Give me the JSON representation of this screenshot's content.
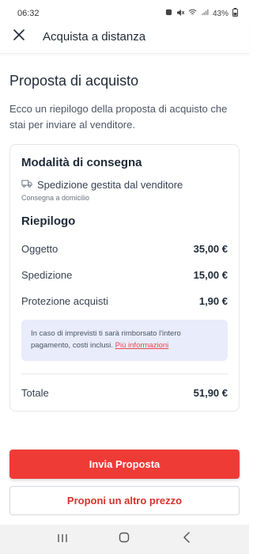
{
  "status_bar": {
    "time": "06:32",
    "battery": "43%"
  },
  "app_bar": {
    "title": "Acquista a distanza",
    "close_icon": "close-icon"
  },
  "page": {
    "title": "Proposta di acquisto",
    "description": "Ecco un riepilogo della proposta di acquisto che stai per inviare al venditore."
  },
  "delivery": {
    "title": "Modalità di consegna",
    "method": "Spedizione gestita dal venditore",
    "method_icon": "truck-icon",
    "sub": "Consegna a domicilio"
  },
  "summary": {
    "title": "Riepilogo",
    "rows": [
      {
        "label": "Oggetto",
        "value": "35,00 €"
      },
      {
        "label": "Spedizione",
        "value": "15,00 €"
      },
      {
        "label": "Protezione acquisti",
        "value": "1,90 €"
      }
    ],
    "info_text": "In caso di imprevisti ti sarà rimborsato l'intero pagamento, costi inclusi.",
    "info_link": "Più informazioni",
    "total_label": "Totale",
    "total_value": "51,90 €"
  },
  "actions": {
    "primary": "Invia Proposta",
    "secondary": "Proponi un altro prezzo"
  },
  "colors": {
    "accent": "#ef3b36",
    "info_bg": "#e8ecfb",
    "link": "#e5484d"
  }
}
